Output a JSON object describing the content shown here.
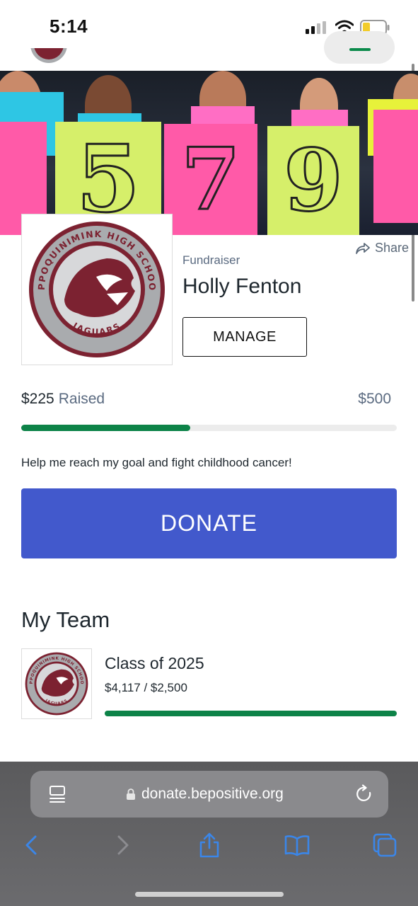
{
  "status_bar": {
    "time": "5:14"
  },
  "hero": {
    "sign_digits": [
      "5",
      ",",
      "7",
      "9"
    ]
  },
  "profile": {
    "share_label": "Share",
    "role": "Fundraiser",
    "name": "Holly Fenton",
    "manage_label": "MANAGE",
    "logo_text_top": "APPOQUINIMINK HIGH SCHOOL",
    "logo_text_bottom": "JAGUARS"
  },
  "progress": {
    "raised_amount": "$225",
    "raised_label": "Raised",
    "goal": "$500",
    "fraction": 0.45
  },
  "message": "Help me reach my goal and fight childhood cancer!",
  "donate_label": "DONATE",
  "team": {
    "heading": "My Team",
    "name": "Class of 2025",
    "amount": "$4,117 / $2,500",
    "fraction": 1.0
  },
  "browser": {
    "url": "donate.bepositive.org"
  },
  "colors": {
    "accent_green": "#0d8348",
    "donate_blue": "#4259cc",
    "maroon": "#7c2231"
  }
}
